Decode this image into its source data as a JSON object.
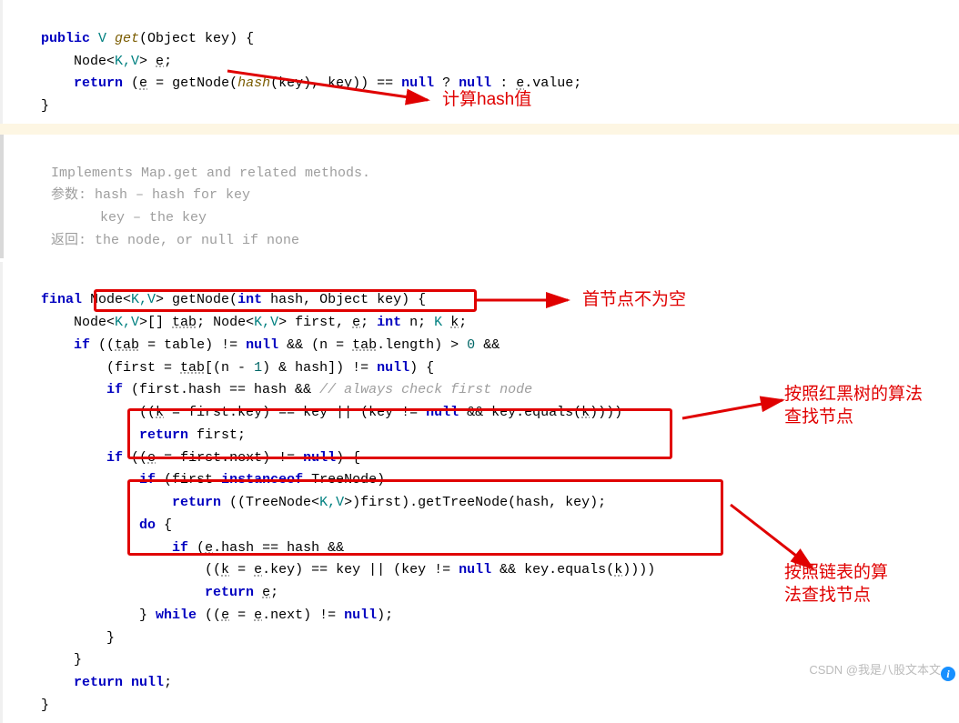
{
  "code1": {
    "l1_pre": "public ",
    "l1_type": "V",
    "l1_func": " get",
    "l1_post": "(Object key) {",
    "l2_pre": "    Node<",
    "l2_kv": "K,V",
    "l2_post": "> ",
    "l2_var": "e",
    "l2_end": ";",
    "l3_pre": "    ",
    "l3_return": "return",
    "l3_p2": " (",
    "l3_e": "e",
    "l3_p3": " = getNode(",
    "l3_hash": "hash",
    "l3_p4": "(key), key)) == ",
    "l3_null1": "null",
    "l3_p5": " ? ",
    "l3_null2": "null",
    "l3_p6": " : ",
    "l3_e2": "e",
    "l3_p7": ".value;",
    "l4": "}"
  },
  "doc": {
    "l1": "Implements Map.get and related methods.",
    "l2": "参数: hash – hash for key",
    "l3": "      key – the key",
    "l4": "返回: the node, or null if none"
  },
  "code2": {
    "l1a": "final",
    "l1b": " Node<",
    "l1kv": "K,V",
    "l1c": "> getNode(",
    "l1int": "int",
    "l1d": " hash, Object key) {",
    "l2a": "    Node<",
    "l2kv1": "K,V",
    "l2b": ">[] ",
    "l2tab": "tab",
    "l2c": "; Node<",
    "l2kv2": "K,V",
    "l2d": "> first, ",
    "l2e": "e",
    "l2f": "; ",
    "l2int": "int",
    "l2g": " n; ",
    "l2K": "K",
    "l2h": " ",
    "l2k": "k",
    "l2i": ";",
    "l3a": "    ",
    "l3if": "if",
    "l3b": " ((",
    "l3tab": "tab",
    "l3c": " = table) != ",
    "l3null": "null",
    "l3d": " && (n = ",
    "l3tab2": "tab",
    "l3e": ".length) > ",
    "l3zero": "0",
    "l3f": " &&",
    "l4a": "        (first = ",
    "l4tab": "tab",
    "l4b": "[(n - ",
    "l4one": "1",
    "l4c": ") & hash]) != ",
    "l4null": "null",
    "l4d": ") {",
    "l5a": "        ",
    "l5if": "if",
    "l5b": " (first.hash == hash && ",
    "l5cmt": "// always check first node",
    "l6a": "            ((",
    "l6k": "k",
    "l6b": " = first.key) == key || (key != ",
    "l6null": "null",
    "l6c": " && key.equals(",
    "l6k2": "k",
    "l6d": "))))",
    "l7a": "            ",
    "l7ret": "return",
    "l7b": " first;",
    "l8a": "        ",
    "l8if": "if",
    "l8b": " ((",
    "l8e": "e",
    "l8c": " = first.next) != ",
    "l8null": "null",
    "l8d": ") {",
    "l9a": "            ",
    "l9if": "if",
    "l9b": " (first ",
    "l9inst": "instanceof",
    "l9c": " TreeNode)",
    "l10a": "                ",
    "l10ret": "return",
    "l10b": " ((TreeNode<",
    "l10kv": "K,V",
    "l10c": ">)first).getTreeNode(hash, key);",
    "l11a": "            ",
    "l11do": "do",
    "l11b": " {",
    "l12a": "                ",
    "l12if": "if",
    "l12b": " (",
    "l12e": "e",
    "l12c": ".hash == hash &&",
    "l13a": "                    ((",
    "l13k": "k",
    "l13b": " = ",
    "l13e": "e",
    "l13c": ".key) == key || (key != ",
    "l13null": "null",
    "l13d": " && key.equals(",
    "l13k2": "k",
    "l13f": "))))",
    "l14a": "                    ",
    "l14ret": "return",
    "l14b": " ",
    "l14e": "e",
    "l14c": ";",
    "l15a": "            } ",
    "l15while": "while",
    "l15b": " ((",
    "l15e": "e",
    "l15c": " = ",
    "l15e2": "e",
    "l15d": ".next) != ",
    "l15null": "null",
    "l15f": ");",
    "l16": "        }",
    "l17": "    }",
    "l18a": "    ",
    "l18ret": "return",
    "l18b": " ",
    "l18null": "null",
    "l18c": ";",
    "l19": "}"
  },
  "anno": {
    "a1": "计算hash值",
    "a2": "首节点不为空",
    "a3_line1": "按照红黑树的算法",
    "a3_line2": "查找节点",
    "a4_line1": "按照链表的算",
    "a4_line2": "法查找节点"
  },
  "watermark": "CSDN @我是八股文本文",
  "info_icon": "i"
}
